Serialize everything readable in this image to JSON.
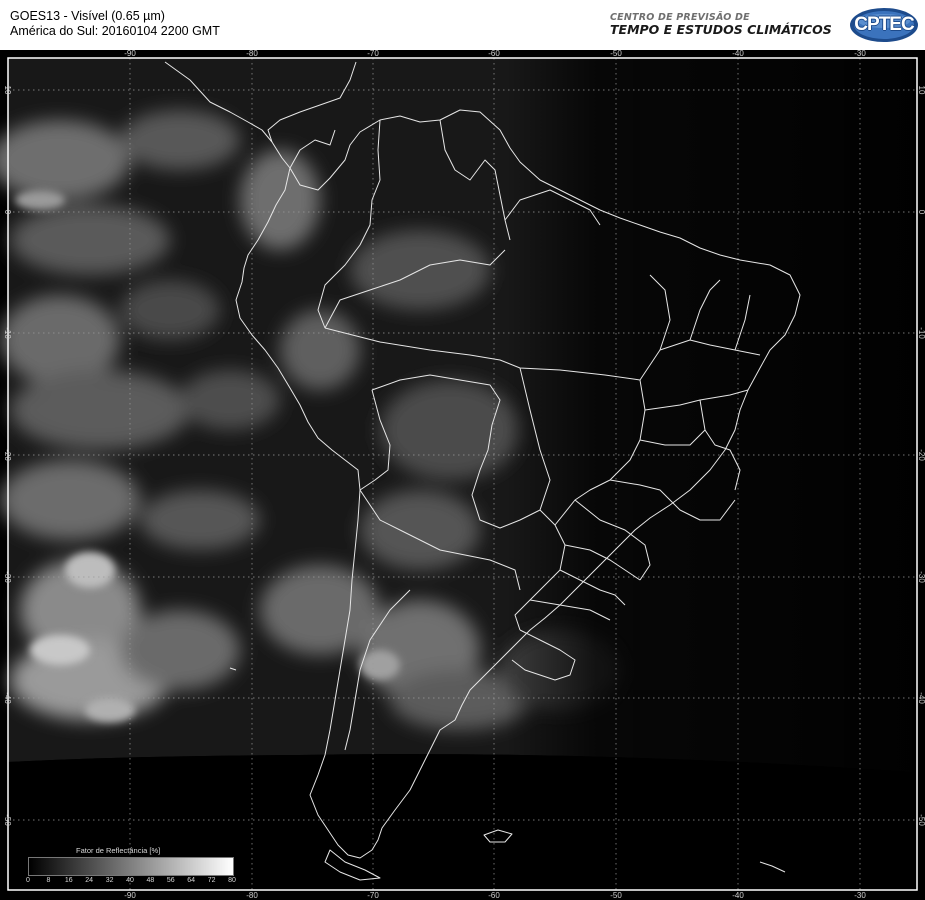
{
  "header": {
    "title_line1": "GOES13 - Visível (0.65 µm)",
    "title_line2": "América do Sul: 20160104 2200 GMT",
    "org_line1": "CENTRO DE PREVISÃO DE",
    "org_line2": "TEMPO E ESTUDOS CLIMÁTICOS",
    "logo_text": "CPTEC"
  },
  "map": {
    "longitude_labels": [
      "-90",
      "-80",
      "-70",
      "-60",
      "-50",
      "-40",
      "-30"
    ],
    "latitude_labels": [
      "10",
      "0",
      "-10",
      "-20",
      "-30",
      "-40",
      "-50"
    ],
    "colors": {
      "frame": "#ffffff",
      "background": "#000000",
      "grid": "#9a9a9a",
      "coastline": "#e6e6e6"
    }
  },
  "legend": {
    "title": "Fator de Reflectância [%]",
    "ticks": [
      "0",
      "8",
      "16",
      "24",
      "32",
      "40",
      "48",
      "56",
      "64",
      "72",
      "80"
    ],
    "range": [
      0,
      80
    ],
    "colormap": "grayscale"
  }
}
